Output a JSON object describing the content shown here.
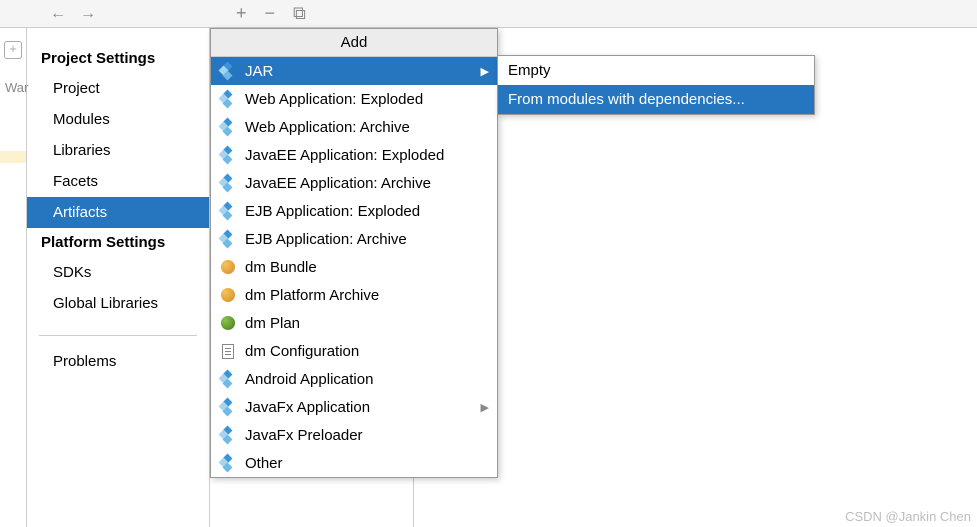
{
  "toolbar": {
    "back": "←",
    "forward": "→",
    "add": "+",
    "remove": "−",
    "copy": "⧉"
  },
  "gutter": {
    "icon_glyph": "+",
    "vertical_text": "War"
  },
  "sidebar": {
    "section1_title": "Project Settings",
    "section1": [
      {
        "label": "Project"
      },
      {
        "label": "Modules"
      },
      {
        "label": "Libraries"
      },
      {
        "label": "Facets"
      },
      {
        "label": "Artifacts"
      }
    ],
    "section2_title": "Platform Settings",
    "section2": [
      {
        "label": "SDKs"
      },
      {
        "label": "Global Libraries"
      }
    ],
    "section3": [
      {
        "label": "Problems"
      }
    ]
  },
  "popup": {
    "title": "Add",
    "items": [
      {
        "label": "JAR",
        "icon": "diamonds",
        "submenu": true,
        "selected": true
      },
      {
        "label": "Web Application: Exploded",
        "icon": "diamonds"
      },
      {
        "label": "Web Application: Archive",
        "icon": "diamonds"
      },
      {
        "label": "JavaEE Application: Exploded",
        "icon": "diamonds"
      },
      {
        "label": "JavaEE Application: Archive",
        "icon": "diamonds"
      },
      {
        "label": "EJB Application: Exploded",
        "icon": "diamonds"
      },
      {
        "label": "EJB Application: Archive",
        "icon": "diamonds"
      },
      {
        "label": "dm Bundle",
        "icon": "globe"
      },
      {
        "label": "dm Platform Archive",
        "icon": "globe"
      },
      {
        "label": "dm Plan",
        "icon": "sphere"
      },
      {
        "label": "dm Configuration",
        "icon": "doc"
      },
      {
        "label": "Android Application",
        "icon": "diamonds"
      },
      {
        "label": "JavaFx Application",
        "icon": "diamonds",
        "submenu": true
      },
      {
        "label": "JavaFx Preloader",
        "icon": "diamonds"
      },
      {
        "label": "Other",
        "icon": "diamonds"
      }
    ]
  },
  "subpopup": {
    "items": [
      {
        "label": "Empty"
      },
      {
        "label": "From modules with dependencies...",
        "selected": true
      }
    ]
  },
  "watermark": "CSDN @Jankin   Chen"
}
